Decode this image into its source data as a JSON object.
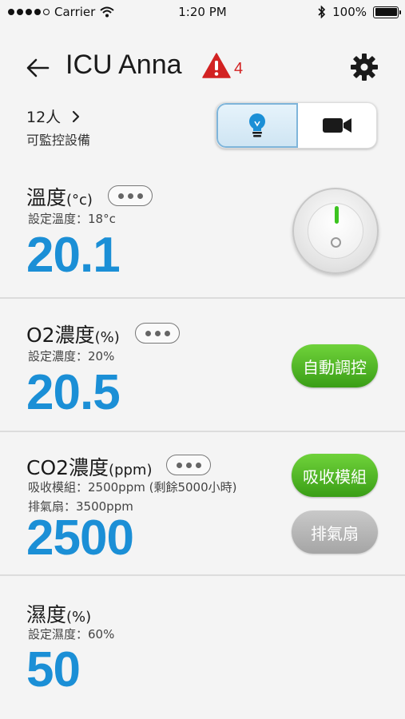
{
  "status_bar": {
    "carrier": "Carrier",
    "time": "1:20 PM",
    "battery": "100%"
  },
  "header": {
    "title": "ICU Anna",
    "alert_count": "4"
  },
  "devices": {
    "count": "12人",
    "label": "可監控設備"
  },
  "sections": {
    "temperature": {
      "title": "溫度",
      "unit": "(°c)",
      "setting": "設定溫度：18°c",
      "value": "20.1"
    },
    "o2": {
      "title": "O2濃度",
      "unit": "(%)",
      "setting": "設定濃度：20%",
      "value": "20.5",
      "button": "自動調控"
    },
    "co2": {
      "title": "CO2濃度",
      "unit": "(ppm)",
      "line1": "吸收模組：2500ppm (剩餘5000小時)",
      "line2": "排氣扇：3500ppm",
      "value": "2500",
      "button_absorb": "吸收模組",
      "button_fan": "排氣扇"
    },
    "humidity": {
      "title": "濕度",
      "unit": "(%)",
      "setting": "設定濕度：60%",
      "value": "50"
    }
  },
  "colors": {
    "value_blue": "#1b8fd6",
    "alert_red": "#d22222",
    "green": "#4bb21f"
  }
}
